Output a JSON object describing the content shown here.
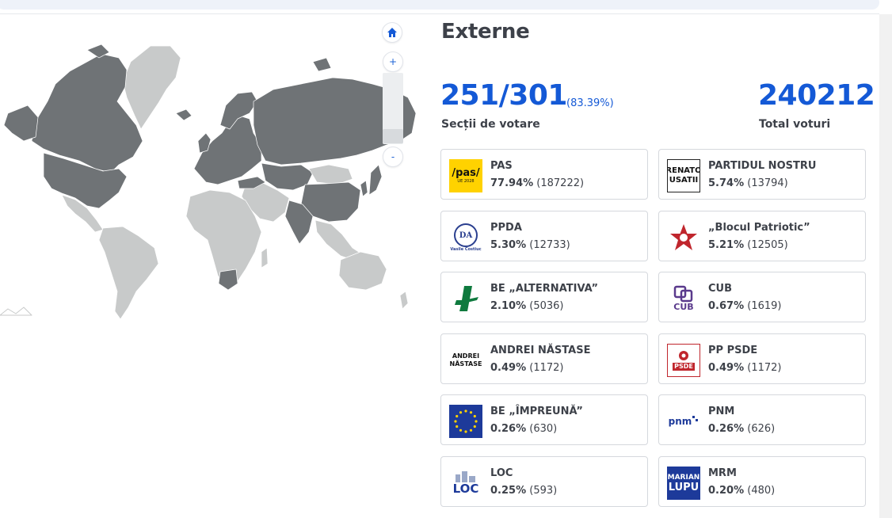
{
  "page": {
    "title": "Externe"
  },
  "stats": {
    "sections": "251/301",
    "sections_pct": "(83.39%)",
    "sections_label": "Secții de votare",
    "total": "240212",
    "total_label": "Total voturi"
  },
  "map": {
    "home_icon": "home-icon",
    "zoom_in": "+",
    "zoom_out": "-",
    "colors": {
      "reporting": "#6f7376",
      "not_reporting": "#c8caca",
      "border": "#ffffff"
    }
  },
  "parties": [
    {
      "name": "PAS",
      "pct": "77.94%",
      "votes": "(187222)",
      "logo": "pas-logo",
      "logo_text": "/pas/",
      "logo_sub": "UE 2028"
    },
    {
      "name": "PARTIDUL NOSTRU",
      "pct": "5.74%",
      "votes": "(13794)",
      "logo": "renato-usatii-logo",
      "logo_text": "RENATO",
      "logo_sub": "USATII"
    },
    {
      "name": "PPDA",
      "pct": "5.30%",
      "votes": "(12733)",
      "logo": "ppda-logo",
      "logo_text": "DA",
      "logo_sub": "Vasile Costiuc"
    },
    {
      "name": "„Blocul Patriotic”",
      "pct": "5.21%",
      "votes": "(12505)",
      "logo": "blocul-patriotic-logo",
      "logo_text": "",
      "logo_sub": ""
    },
    {
      "name": "BE „ALTERNATIVA”",
      "pct": "2.10%",
      "votes": "(5036)",
      "logo": "alternativa-logo",
      "logo_text": "",
      "logo_sub": ""
    },
    {
      "name": "CUB",
      "pct": "0.67%",
      "votes": "(1619)",
      "logo": "cub-logo",
      "logo_text": "CUB",
      "logo_sub": ""
    },
    {
      "name": "ANDREI NĂSTASE",
      "pct": "0.49%",
      "votes": "(1172)",
      "logo": "andrei-nastase-logo",
      "logo_text": "ANDREI",
      "logo_sub": "NĂSTASE"
    },
    {
      "name": "PP PSDE",
      "pct": "0.49%",
      "votes": "(1172)",
      "logo": "psde-logo",
      "logo_text": "PSDE",
      "logo_sub": ""
    },
    {
      "name": "BE „ÎMPREUNĂ”",
      "pct": "0.26%",
      "votes": "(630)",
      "logo": "impreuna-logo",
      "logo_text": "",
      "logo_sub": ""
    },
    {
      "name": "PNM",
      "pct": "0.26%",
      "votes": "(626)",
      "logo": "pnm-logo",
      "logo_text": "pnm",
      "logo_sub": ""
    },
    {
      "name": "LOC",
      "pct": "0.25%",
      "votes": "(593)",
      "logo": "loc-logo",
      "logo_text": "LOC",
      "logo_sub": ""
    },
    {
      "name": "MRM",
      "pct": "0.20%",
      "votes": "(480)",
      "logo": "marian-lupu-logo",
      "logo_text": "MARIAN",
      "logo_sub": "LUPU"
    }
  ]
}
